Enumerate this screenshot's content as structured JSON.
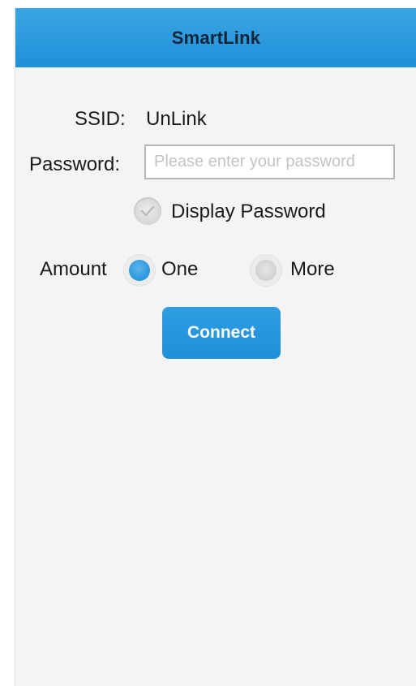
{
  "header": {
    "title": "SmartLink"
  },
  "form": {
    "ssid_label": "SSID:",
    "ssid_value": "UnLink",
    "password_label": "Password:",
    "password_value": "",
    "password_placeholder": "Please enter your password",
    "display_password_label": "Display Password",
    "display_password_checked": false,
    "amount_label": "Amount",
    "amount_options": [
      {
        "label": "One",
        "selected": true
      },
      {
        "label": "More",
        "selected": false
      }
    ],
    "connect_label": "Connect"
  },
  "colors": {
    "accent": "#2a96dc",
    "navbar": "#2b9ae0",
    "background": "#f4f4f4"
  },
  "icons": {
    "display_password": "check-icon"
  }
}
